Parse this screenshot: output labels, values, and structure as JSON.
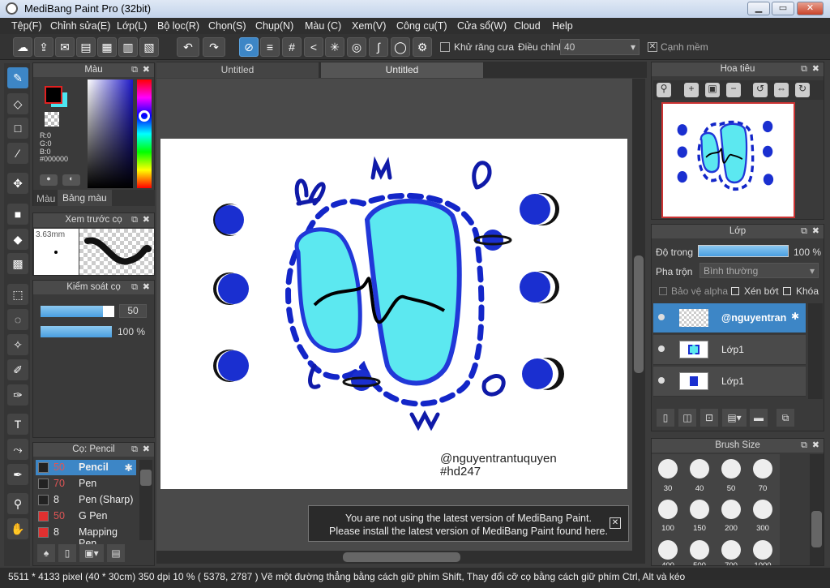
{
  "window": {
    "title": "MediBang Paint Pro (32bit)",
    "minimize": "▁",
    "maximize": "▭",
    "close": "✕"
  },
  "menu": [
    "Tệp(F)",
    "Chỉnh sửa(E)",
    "Lớp(L)",
    "Bộ lọc(R)",
    "Chọn(S)",
    "Chụp(N)",
    "Màu (C)",
    "Xem(V)",
    "Công cụ(T)",
    "Cửa sổ(W)",
    "Cloud",
    "Help"
  ],
  "toolbar": {
    "antialias_label": "Khử răng cưa",
    "adjust_label": "Điều chỉnh",
    "adjust_value": "40",
    "smooth_label": "Cạnh mềm"
  },
  "tabs": [
    "Untitled",
    "Untitled"
  ],
  "color_panel": {
    "title": "Màu",
    "r": "R:0",
    "g": "G:0",
    "b": "B:0",
    "hex": "#000000",
    "tab_color": "Màu",
    "tab_palette": "Bảng màu"
  },
  "brush_preview": {
    "title": "Xem trước cọ",
    "size": "3.63mm"
  },
  "brush_control": {
    "title": "Kiểm soát cọ",
    "size_value": "50",
    "opacity_value": "100 %",
    "size_fill": 0.85,
    "opacity_fill": 1.0
  },
  "brush_list": {
    "title": "Cọ: Pencil",
    "items": [
      {
        "num": "50",
        "name": "Pencil",
        "color": "#222222",
        "active": true
      },
      {
        "num": "70",
        "name": "Pen",
        "color": "#222222",
        "active": false
      },
      {
        "num": "8",
        "name": "Pen (Sharp)",
        "color": "#222222",
        "active": false
      },
      {
        "num": "50",
        "name": "G Pen",
        "color": "#e03030",
        "active": false
      },
      {
        "num": "8",
        "name": "Mapping Pen",
        "color": "#e03030",
        "active": false
      }
    ]
  },
  "navigator": {
    "title": "Hoa tiêu"
  },
  "layers": {
    "title": "Lớp",
    "opacity_label": "Độ trong",
    "opacity_value": "100 %",
    "blend_label": "Pha trộn",
    "blend_value": "Bình thường",
    "protect_alpha": "Bảo vệ alpha",
    "clip": "Xén bớt",
    "lock": "Khóa",
    "items": [
      {
        "name": "@nguyentran",
        "active": true
      },
      {
        "name": "Lớp1",
        "active": false
      },
      {
        "name": "Lớp1",
        "active": false
      }
    ]
  },
  "brush_size": {
    "title": "Brush Size",
    "sizes": [
      "30",
      "40",
      "50",
      "70",
      "100",
      "150",
      "200",
      "300",
      "400",
      "500",
      "700",
      "1000"
    ]
  },
  "canvas": {
    "signature": "@nguyentrantuquyen",
    "hashtag": "#hd247"
  },
  "notice": {
    "line1": "You are not using the latest version of MediBang Paint.",
    "line2": "Please install the latest version of MediBang Paint found here."
  },
  "status": {
    "text": "5511 * 4133 pixel  (40 * 30cm)  350 dpi  10 %  ( 5378, 2787 )  Vẽ một đường thẳng bằng cách giữ phím Shift, Thay đổi cỡ cọ bằng cách giữ phím Ctrl, Alt và kéo"
  },
  "colors": {
    "accent": "#3d86c6",
    "cyan": "#5ce8f0",
    "blue": "#1a2fd0",
    "navy": "#0f1aa8"
  }
}
